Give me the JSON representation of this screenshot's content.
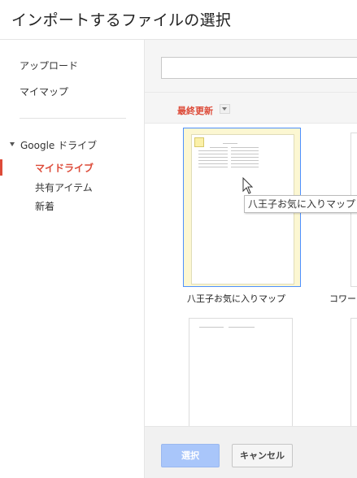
{
  "dialog": {
    "title": "インポートするファイルの選択"
  },
  "sidebar": {
    "upload": "アップロード",
    "my_maps": "マイマップ",
    "google_drive": "Google ドライブ",
    "drive_items": [
      "マイドライブ",
      "共有アイテム",
      "新着"
    ],
    "selected_index": 0,
    "accent_color": "#dd4b39"
  },
  "main": {
    "search": {
      "value": "",
      "placeholder": ""
    },
    "sort": {
      "label": "最終更新"
    },
    "files": [
      {
        "name": "八王子お気に入りマップ"
      },
      {
        "name": "コワー"
      }
    ],
    "tooltip": "八王子お気に入りマップ"
  },
  "footer": {
    "select_label": "選択",
    "cancel_label": "キャンセル"
  }
}
